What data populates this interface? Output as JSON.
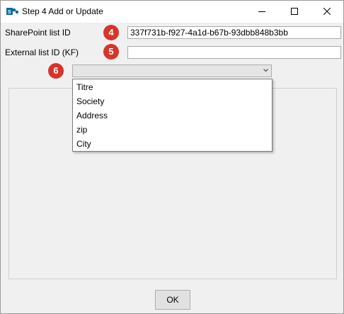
{
  "window": {
    "title": "Step 4 Add or Update"
  },
  "form": {
    "sharepoint_label": "SharePoint list ID",
    "sharepoint_value": "337f731b-f927-4a1d-b67b-93dbb848b3bb",
    "external_label": "External list ID (KF)",
    "external_value": ""
  },
  "badges": {
    "b4": "4",
    "b5": "5",
    "b6": "6"
  },
  "combo": {
    "selected": "",
    "options": [
      "Titre",
      "Society",
      "Address",
      "zip",
      "City"
    ]
  },
  "buttons": {
    "ok_label": "OK"
  },
  "colors": {
    "badge": "#d6352b",
    "window_bg": "#f0f0f0",
    "app_icon": "#0b6a9e"
  }
}
